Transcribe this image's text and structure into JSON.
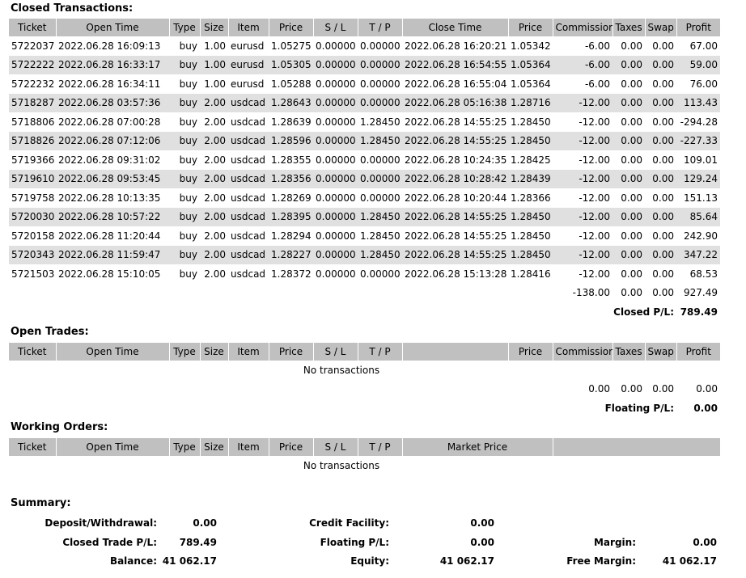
{
  "closed": {
    "title": "Closed Transactions:",
    "headers": [
      "Ticket",
      "Open Time",
      "Type",
      "Size",
      "Item",
      "Price",
      "S / L",
      "T / P",
      "Close Time",
      "Price",
      "Commission",
      "Taxes",
      "Swap",
      "Profit"
    ],
    "rows": [
      [
        "5722037",
        "2022.06.28 16:09:13",
        "buy",
        "1.00",
        "eurusd",
        "1.05275",
        "0.00000",
        "0.00000",
        "2022.06.28 16:20:21",
        "1.05342",
        "-6.00",
        "0.00",
        "0.00",
        "67.00"
      ],
      [
        "5722222",
        "2022.06.28 16:33:17",
        "buy",
        "1.00",
        "eurusd",
        "1.05305",
        "0.00000",
        "0.00000",
        "2022.06.28 16:54:55",
        "1.05364",
        "-6.00",
        "0.00",
        "0.00",
        "59.00"
      ],
      [
        "5722232",
        "2022.06.28 16:34:11",
        "buy",
        "1.00",
        "eurusd",
        "1.05288",
        "0.00000",
        "0.00000",
        "2022.06.28 16:55:04",
        "1.05364",
        "-6.00",
        "0.00",
        "0.00",
        "76.00"
      ],
      [
        "5718287",
        "2022.06.28 03:57:36",
        "buy",
        "2.00",
        "usdcad",
        "1.28643",
        "0.00000",
        "0.00000",
        "2022.06.28 05:16:38",
        "1.28716",
        "-12.00",
        "0.00",
        "0.00",
        "113.43"
      ],
      [
        "5718806",
        "2022.06.28 07:00:28",
        "buy",
        "2.00",
        "usdcad",
        "1.28639",
        "0.00000",
        "1.28450",
        "2022.06.28 14:55:25",
        "1.28450",
        "-12.00",
        "0.00",
        "0.00",
        "-294.28"
      ],
      [
        "5718826",
        "2022.06.28 07:12:06",
        "buy",
        "2.00",
        "usdcad",
        "1.28596",
        "0.00000",
        "1.28450",
        "2022.06.28 14:55:25",
        "1.28450",
        "-12.00",
        "0.00",
        "0.00",
        "-227.33"
      ],
      [
        "5719366",
        "2022.06.28 09:31:02",
        "buy",
        "2.00",
        "usdcad",
        "1.28355",
        "0.00000",
        "0.00000",
        "2022.06.28 10:24:35",
        "1.28425",
        "-12.00",
        "0.00",
        "0.00",
        "109.01"
      ],
      [
        "5719610",
        "2022.06.28 09:53:45",
        "buy",
        "2.00",
        "usdcad",
        "1.28356",
        "0.00000",
        "0.00000",
        "2022.06.28 10:28:42",
        "1.28439",
        "-12.00",
        "0.00",
        "0.00",
        "129.24"
      ],
      [
        "5719758",
        "2022.06.28 10:13:35",
        "buy",
        "2.00",
        "usdcad",
        "1.28269",
        "0.00000",
        "0.00000",
        "2022.06.28 10:20:44",
        "1.28366",
        "-12.00",
        "0.00",
        "0.00",
        "151.13"
      ],
      [
        "5720030",
        "2022.06.28 10:57:22",
        "buy",
        "2.00",
        "usdcad",
        "1.28395",
        "0.00000",
        "1.28450",
        "2022.06.28 14:55:25",
        "1.28450",
        "-12.00",
        "0.00",
        "0.00",
        "85.64"
      ],
      [
        "5720158",
        "2022.06.28 11:20:44",
        "buy",
        "2.00",
        "usdcad",
        "1.28294",
        "0.00000",
        "1.28450",
        "2022.06.28 14:55:25",
        "1.28450",
        "-12.00",
        "0.00",
        "0.00",
        "242.90"
      ],
      [
        "5720343",
        "2022.06.28 11:59:47",
        "buy",
        "2.00",
        "usdcad",
        "1.28227",
        "0.00000",
        "1.28450",
        "2022.06.28 14:55:25",
        "1.28450",
        "-12.00",
        "0.00",
        "0.00",
        "347.22"
      ],
      [
        "5721503",
        "2022.06.28 15:10:05",
        "buy",
        "2.00",
        "usdcad",
        "1.28372",
        "0.00000",
        "0.00000",
        "2022.06.28 15:13:28",
        "1.28416",
        "-12.00",
        "0.00",
        "0.00",
        "68.53"
      ]
    ],
    "totals": {
      "commission": "-138.00",
      "taxes": "0.00",
      "swap": "0.00",
      "profit": "927.49"
    },
    "pl_label": "Closed P/L:",
    "pl_value": "789.49"
  },
  "open": {
    "title": "Open Trades:",
    "headers": [
      "Ticket",
      "Open Time",
      "Type",
      "Size",
      "Item",
      "Price",
      "S / L",
      "T / P",
      "",
      "Price",
      "Commission",
      "Taxes",
      "Swap",
      "Profit"
    ],
    "empty": "No transactions",
    "totals": {
      "commission": "0.00",
      "taxes": "0.00",
      "swap": "0.00",
      "profit": "0.00"
    },
    "pl_label": "Floating P/L:",
    "pl_value": "0.00"
  },
  "working": {
    "title": "Working Orders:",
    "headers": [
      "Ticket",
      "Open Time",
      "Type",
      "Size",
      "Item",
      "Price",
      "S / L",
      "T / P",
      "Market Price",
      ""
    ],
    "empty": "No transactions"
  },
  "summary": {
    "title": "Summary:",
    "deposit_label": "Deposit/Withdrawal:",
    "deposit_value": "0.00",
    "closed_pl_label": "Closed Trade P/L:",
    "closed_pl_value": "789.49",
    "balance_label": "Balance:",
    "balance_value": "41 062.17",
    "credit_label": "Credit Facility:",
    "credit_value": "0.00",
    "floating_label": "Floating P/L:",
    "floating_value": "0.00",
    "equity_label": "Equity:",
    "equity_value": "41 062.17",
    "margin_label": "Margin:",
    "margin_value": "0.00",
    "free_margin_label": "Free Margin:",
    "free_margin_value": "41 062.17"
  }
}
